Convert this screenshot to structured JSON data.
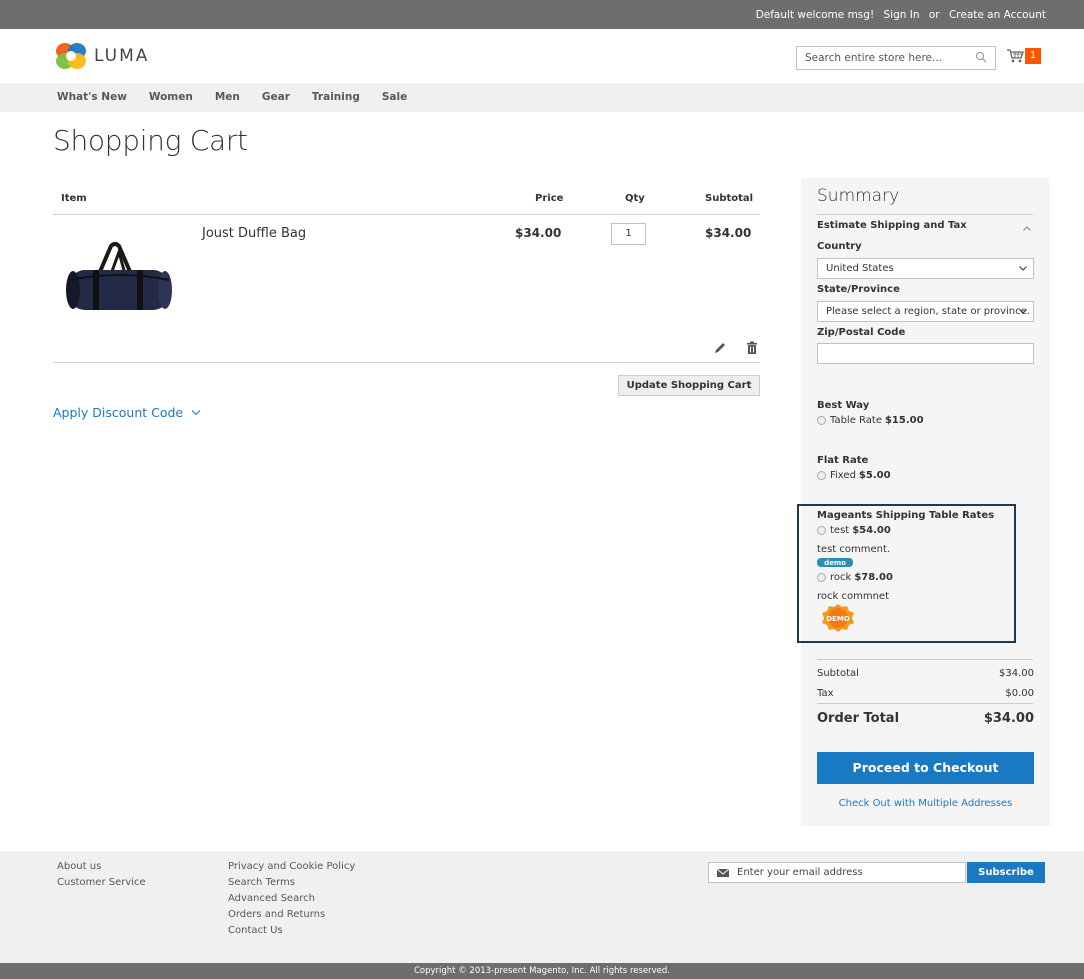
{
  "topbar": {
    "welcome": "Default welcome msg!",
    "sign_in": "Sign In",
    "or": "or",
    "create_account": "Create an Account"
  },
  "header": {
    "logo_text": "LUMA",
    "search_placeholder": "Search entire store here...",
    "cart_count": "1"
  },
  "nav": {
    "items": [
      "What's New",
      "Women",
      "Men",
      "Gear",
      "Training",
      "Sale"
    ]
  },
  "page": {
    "title": "Shopping Cart"
  },
  "cart": {
    "headers": {
      "item": "Item",
      "price": "Price",
      "qty": "Qty",
      "subtotal": "Subtotal"
    },
    "item": {
      "name": "Joust Duffle Bag",
      "price": "$34.00",
      "qty": "1",
      "subtotal": "$34.00"
    },
    "update_label": "Update Shopping Cart",
    "discount_label": "Apply Discount Code"
  },
  "summary": {
    "title": "Summary",
    "estimate_label": "Estimate Shipping and Tax",
    "country_label": "Country",
    "country_value": "United States",
    "state_label": "State/Province",
    "state_value": "Please select a region, state or province.",
    "zip_label": "Zip/Postal Code",
    "shipping": {
      "best_way_title": "Best Way",
      "best_way_option": "Table Rate",
      "best_way_price": "$15.00",
      "flat_rate_title": "Flat Rate",
      "flat_rate_option": "Fixed",
      "flat_rate_price": "$5.00",
      "mageants_title": "Mageants Shipping Table Rates",
      "test_option": "test",
      "test_price": "$54.00",
      "test_comment": "test comment.",
      "rock_option": "rock",
      "rock_price": "$78.00",
      "rock_comment": "rock commnet",
      "demo_badge_text": "DEMO",
      "demo_small_text": "demo"
    },
    "totals": {
      "subtotal_label": "Subtotal",
      "subtotal_value": "$34.00",
      "tax_label": "Tax",
      "tax_value": "$0.00",
      "order_total_label": "Order Total",
      "order_total_value": "$34.00"
    },
    "checkout_label": "Proceed to Checkout",
    "multi_label": "Check Out with Multiple Addresses"
  },
  "footer": {
    "col1": [
      "About us",
      "Customer Service"
    ],
    "col2": [
      "Privacy and Cookie Policy",
      "Search Terms",
      "Advanced Search",
      "Orders and Returns",
      "Contact Us"
    ],
    "newsletter_placeholder": "Enter your email address",
    "subscribe_label": "Subscribe",
    "copyright": "Copyright © 2013-present Magento, Inc. All rights reserved."
  },
  "colors": {
    "accent_blue": "#1979c3",
    "cart_badge": "#ff5501",
    "topbar": "#6e6e6e"
  }
}
